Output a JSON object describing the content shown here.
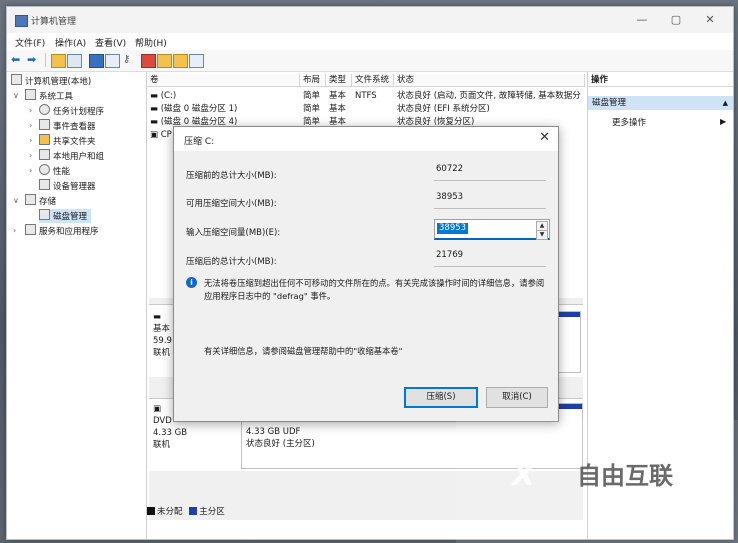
{
  "window": {
    "title": "计算机管理"
  },
  "menu": [
    "文件(F)",
    "操作(A)",
    "查看(V)",
    "帮助(H)"
  ],
  "tree": {
    "root": "计算机管理(本地)",
    "system_tools": "系统工具",
    "task_scheduler": "任务计划程序",
    "event_viewer": "事件查看器",
    "shared_folders": "共享文件夹",
    "local_users": "本地用户和组",
    "performance": "性能",
    "device_manager": "设备管理器",
    "storage": "存储",
    "disk_management": "磁盘管理",
    "services": "服务和应用程序"
  },
  "columns": [
    "卷",
    "布局",
    "类型",
    "文件系统",
    "状态"
  ],
  "volumes": [
    {
      "name": "(C:)",
      "layout": "简单",
      "type": "基本",
      "fs": "NTFS",
      "status": "状态良好 (启动, 页面文件, 故障转储, 基本数据分"
    },
    {
      "name": "(磁盘 0 磁盘分区 1)",
      "layout": "简单",
      "type": "基本",
      "fs": "",
      "status": "状态良好 (EFI 系统分区)"
    },
    {
      "name": "(磁盘 0 磁盘分区 4)",
      "layout": "简单",
      "type": "基本",
      "fs": "",
      "status": "状态良好 (恢复分区)"
    },
    {
      "name": "CP",
      "layout": "",
      "type": "",
      "fs": "",
      "status": ""
    }
  ],
  "disk0": {
    "line1": "基本",
    "line2": "59.9",
    "line3": "联机",
    "cut": "3)"
  },
  "dvd": {
    "line1": "DVD",
    "line2": "4.33 GB",
    "line3": "联机",
    "part_size": "4.33 GB UDF",
    "part_status": "状态良好 (主分区)"
  },
  "legend": {
    "unallocated": "未分配",
    "primary": "主分区"
  },
  "actions": {
    "header": "操作",
    "selected": "磁盘管理",
    "more": "更多操作"
  },
  "dialog": {
    "title": "压缩 C:",
    "total_before_label": "压缩前的总计大小(MB):",
    "total_before_value": "60722",
    "available_label": "可用压缩空间大小(MB):",
    "available_value": "38953",
    "input_label": "输入压缩空间量(MB)(E):",
    "input_value": "38953",
    "total_after_label": "压缩后的总计大小(MB):",
    "total_after_value": "21769",
    "info": "无法将卷压缩到超出任何不可移动的文件所在的点。有关完成该操作时间的详细信息，请参阅应用程序日志中的 \"defrag\" 事件。",
    "help": "有关详细信息，请参阅磁盘管理帮助中的\"收缩基本卷\"",
    "shrink_button": "压缩(S)",
    "cancel_button": "取消(C)"
  },
  "watermark": {
    "brand": "自由互联",
    "site": "好装机"
  }
}
